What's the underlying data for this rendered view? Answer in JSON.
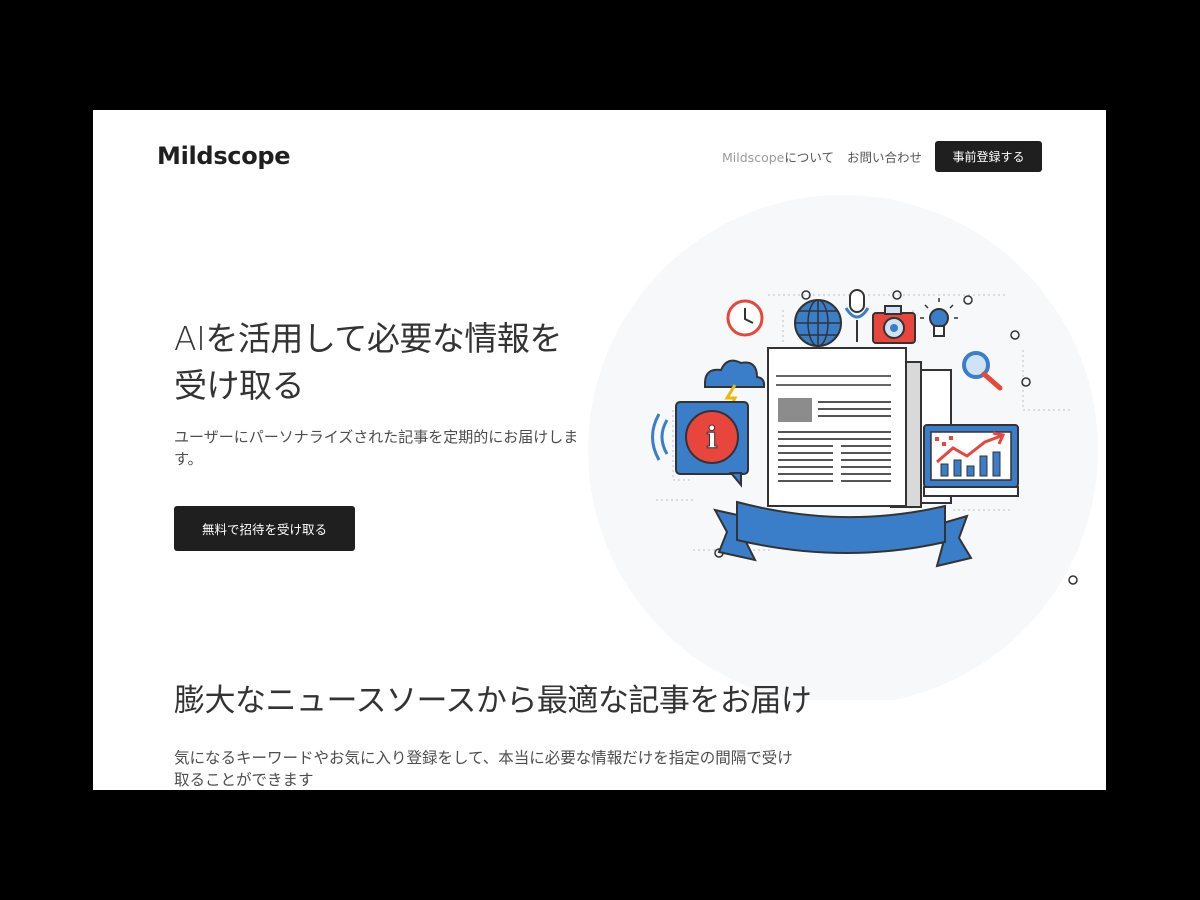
{
  "header": {
    "logo": "Mildscope",
    "nav": {
      "about_brand": "Mildscope",
      "about_suffix": "について",
      "contact": "お問い合わせ",
      "register_button": "事前登録する"
    }
  },
  "hero": {
    "title_ai": "AI",
    "title_rest": "を活用して必要な情報を受け取る",
    "subtitle": "ユーザーにパーソナライズされた記事を定期的にお届けします。",
    "cta_button": "無料で招待を受け取る"
  },
  "illustration": {
    "icon": "news-illustration",
    "colors": {
      "blue": "#3a7dc9",
      "red": "#e8453c",
      "dark": "#333333",
      "light_blue": "#cfe3f4",
      "gray": "#c9c9c9"
    }
  },
  "feature": {
    "title": "膨大なニュースソースから最適な記事をお届け",
    "subtitle": "気になるキーワードやお気に入り登録をして、本当に必要な情報だけを指定の間隔で受け取ることができます"
  },
  "colors": {
    "page_background": "#000000",
    "content_background": "#ffffff",
    "button_background": "#1f1f1f",
    "button_text": "#ffffff"
  }
}
